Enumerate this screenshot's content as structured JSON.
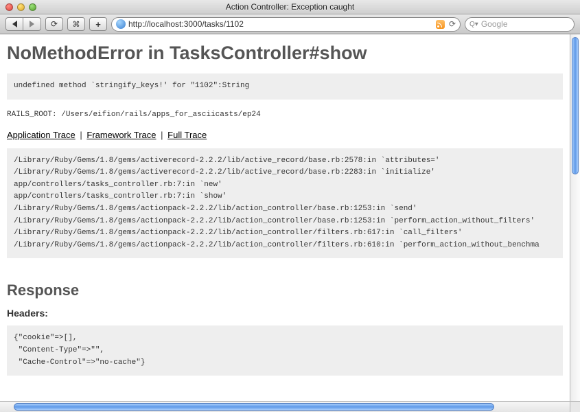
{
  "window": {
    "title": "Action Controller: Exception caught"
  },
  "toolbar": {
    "url": "http://localhost:3000/tasks/1102",
    "search_placeholder": "Google"
  },
  "error": {
    "title": "NoMethodError in TasksController#show",
    "message": "undefined method `stringify_keys!' for \"1102\":String",
    "rails_root_label": "RAILS_ROOT:",
    "rails_root": "/Users/eifion/rails/apps_for_asciicasts/ep24"
  },
  "trace_links": {
    "app": "Application Trace",
    "framework": "Framework Trace",
    "full": "Full Trace"
  },
  "trace": [
    "/Library/Ruby/Gems/1.8/gems/activerecord-2.2.2/lib/active_record/base.rb:2578:in `attributes='",
    "/Library/Ruby/Gems/1.8/gems/activerecord-2.2.2/lib/active_record/base.rb:2283:in `initialize'",
    "app/controllers/tasks_controller.rb:7:in `new'",
    "app/controllers/tasks_controller.rb:7:in `show'",
    "/Library/Ruby/Gems/1.8/gems/actionpack-2.2.2/lib/action_controller/base.rb:1253:in `send'",
    "/Library/Ruby/Gems/1.8/gems/actionpack-2.2.2/lib/action_controller/base.rb:1253:in `perform_action_without_filters'",
    "/Library/Ruby/Gems/1.8/gems/actionpack-2.2.2/lib/action_controller/filters.rb:617:in `call_filters'",
    "/Library/Ruby/Gems/1.8/gems/actionpack-2.2.2/lib/action_controller/filters.rb:610:in `perform_action_without_benchma"
  ],
  "response": {
    "heading": "Response",
    "headers_label": "Headers:",
    "headers_body": "{\"cookie\"=>[],\n \"Content-Type\"=>\"\",\n \"Cache-Control\"=>\"no-cache\"}"
  }
}
